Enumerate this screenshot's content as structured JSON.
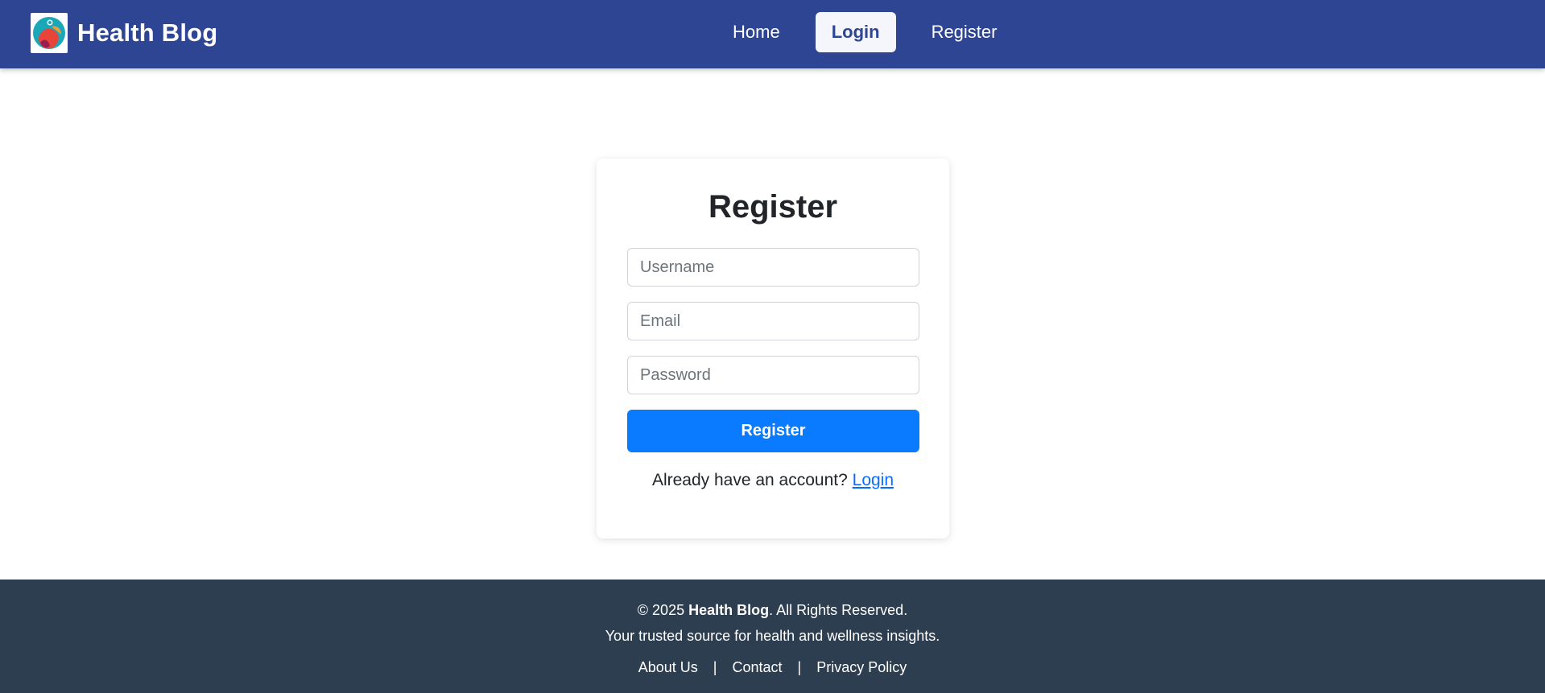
{
  "navbar": {
    "brand_name": "Health Blog",
    "brand_logo_icon": "health-heart-logo-icon",
    "links": [
      {
        "label": "Home"
      },
      {
        "label": "Login",
        "active": true
      },
      {
        "label": "Register"
      }
    ],
    "bg_color": "#2e4593"
  },
  "form": {
    "title": "Register",
    "username_placeholder": "Username",
    "email_placeholder": "Email",
    "password_placeholder": "Password",
    "submit_label": "Register",
    "login_prompt_text": "Already have an account?",
    "login_link_label": "Login",
    "button_color": "#0a7bff"
  },
  "footer": {
    "copyright_prefix": "© 2025",
    "copyright_brand": "Health Blog",
    "copyright_suffix": ". All Rights Reserved.",
    "tagline": "Your trusted source for health and wellness insights.",
    "links": [
      {
        "label": "About Us"
      },
      {
        "label": "Contact"
      },
      {
        "label": "Privacy Policy"
      }
    ],
    "separator": "|",
    "bg_color": "#2d3e50"
  }
}
